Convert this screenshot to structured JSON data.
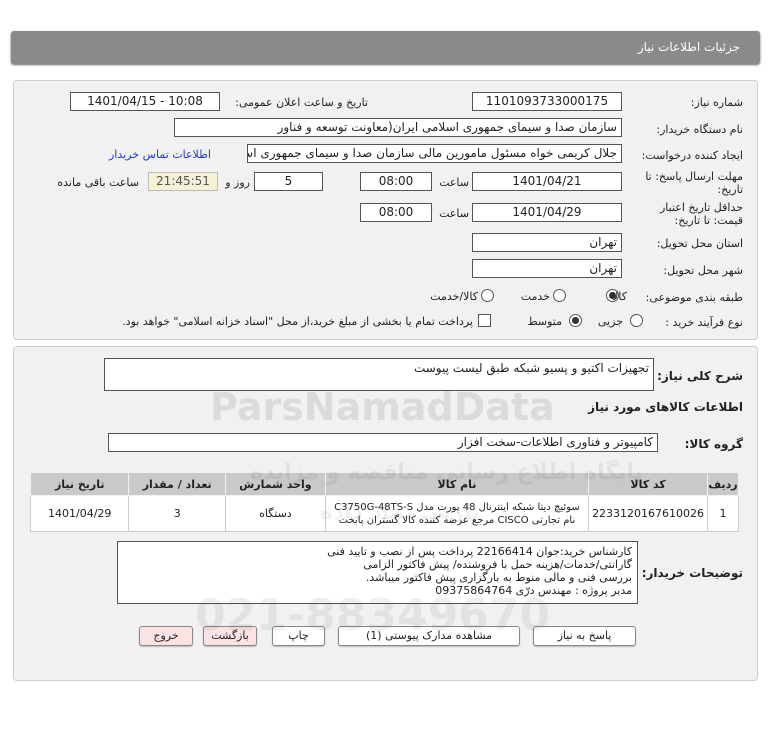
{
  "header": {
    "title": "جزئیات اطلاعات نیاز"
  },
  "form": {
    "need_number_label": "شماره نیاز:",
    "need_number": "1101093733000175",
    "announce_label": "تاریخ و ساعت اعلان عمومی:",
    "announce_value": "1401/04/15 - 10:08",
    "buyer_org_label": "نام دستگاه خریدار:",
    "buyer_org": "سازمان صدا و سیمای جمهوری اسلامی ایران(معاونت توسعه و فناور",
    "creator_label": "ایجاد کننده درخواست:",
    "creator": "جلال کریمی خواه مسئول مامورین مالی  سازمان صدا و سیمای جمهوری اسلا",
    "contact_link": "اطلاعات تماس خریدار",
    "deadline_label_1": "مهلت ارسال پاسخ: تا",
    "deadline_label_2": "تاریخ:",
    "deadline_date": "1401/04/21",
    "time_label": "ساعت",
    "deadline_time": "08:00",
    "days_value": "5",
    "days_label": "روز و",
    "remaining_time": "21:45:51",
    "remaining_label": "ساعت باقی مانده",
    "validity_label_1": "حداقل تاریخ اعتبار",
    "validity_label_2": "قیمت: تا تاریخ:",
    "validity_date": "1401/04/29",
    "validity_time_label": "ساعت",
    "validity_time": "08:00",
    "province_label": "استان محل تحویل:",
    "province": "تهران",
    "city_label": "شهر محل تحویل:",
    "city": "تهران",
    "category_label": "طبقه بندی موضوعی:",
    "category_options": [
      "کالا",
      "خدمت",
      "کالا/خدمت"
    ],
    "category_selected": "کالا",
    "process_label": "نوع فرآیند خرید :",
    "process_options": [
      "جزیی",
      "متوسط"
    ],
    "process_selected": "متوسط",
    "treasury_note": "پرداخت تمام یا بخشی از مبلغ خرید،از محل \"اسناد خزانه اسلامی\" خواهد بود."
  },
  "summary": {
    "label": "شرح کلی نیاز:",
    "value": "تجهیزات اکتیو و پسیو شبکه طبق لیست پیوست"
  },
  "goods": {
    "section_title": "اطلاعات کالاهای مورد نیاز",
    "group_label": "گروه کالا:",
    "group_value": "کامپیوتر و فناوری اطلاعات-سخت افزار",
    "columns": [
      "ردیف",
      "کد کالا",
      "نام کالا",
      "واحد شمارش",
      "تعداد / مقدار",
      "تاریخ نیاز"
    ],
    "rows": [
      {
        "index": "1",
        "code": "2233120167610026",
        "name": "سوئیچ دیتا شبکه اینترنال 48 پورت مدل C3750G-48TS-S نام تجارتی CISCO مرجع عرضه کننده کالا گستران پابخت",
        "unit": "دستگاه",
        "qty": "3",
        "date": "1401/04/29"
      }
    ]
  },
  "buyer_notes": {
    "label": "توضیحات خریدار:",
    "lines": [
      "کارشناس خرید:جوان 22166414    پرداخت پس از نصب و تایید فنی",
      "گارانتی/خدمات/هزینه حمل با فروشنده/ پیش فاکتور الزامی",
      "بررسی فنی و مالی منوط به بارگزاری پیش فاکتور میباشد.",
      "مدیر پروژه : مهندس درّی 09375864764"
    ]
  },
  "buttons": {
    "reply": "پاسخ به نیاز",
    "attachments": "مشاهده مدارک پیوستی (1)",
    "print": "چاپ",
    "back": "بازگشت",
    "exit": "خروج"
  },
  "watermark": {
    "brand": "ParsNamadData",
    "line1": "پایگاه اطلاع رسانی مناقصه و مزایده",
    "line2": "پارس نماد داده",
    "phone": "021-88349670"
  },
  "colors": {
    "header_bg": "#8a8a8a",
    "panel_bg": "#f1f1f1",
    "link": "#1a3ec0",
    "remaining_bg": "#f5f1d4",
    "danger_btn_bg": "#fbe3e3"
  }
}
